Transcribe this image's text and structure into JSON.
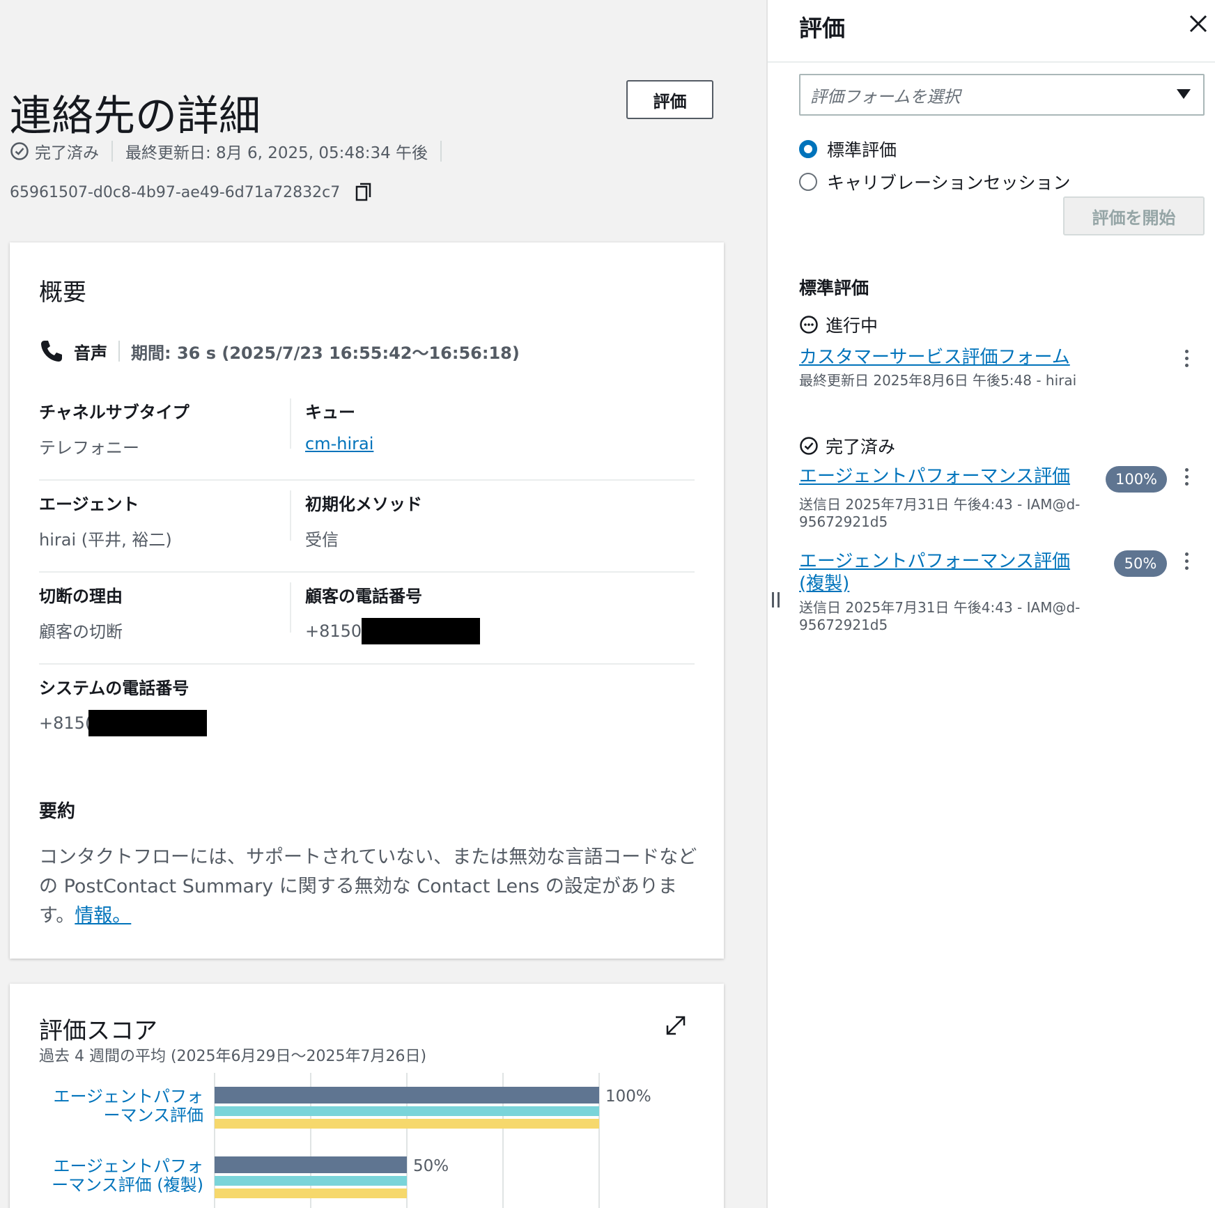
{
  "page": {
    "title": "連絡先の詳細",
    "evaluate_button": "評価",
    "status": "完了済み",
    "last_updated": "最終更新日: 8月 6, 2025, 05:48:34 午後",
    "contact_id": "65961507-d0c8-4b97-ae49-6d71a72832c7"
  },
  "overview": {
    "heading": "概要",
    "channel": "音声",
    "duration": "期間: 36 s (2025/7/23 16:55:42〜16:56:18)",
    "fields": [
      {
        "label": "チャネルサブタイプ",
        "value": "テレフォニー"
      },
      {
        "label": "キュー",
        "value": "cm-hirai"
      },
      {
        "label": "エージェント",
        "value": "hirai (平井, 裕二)"
      },
      {
        "label": "初期化メソッド",
        "value": "受信"
      },
      {
        "label": "切断の理由",
        "value": "顧客の切断"
      },
      {
        "label": "顧客の電話番号",
        "value": "+8150"
      },
      {
        "label": "システムの電話番号",
        "value": "+815("
      }
    ],
    "summary_heading": "要約",
    "summary_text": "コンタクトフローには、サポートされていない、または無効な言語コードなどの PostContact Summary に関する無効な Contact Lens の設定があります。",
    "summary_link": "情報。"
  },
  "score": {
    "heading": "評価スコア",
    "subtitle": "過去 4 週間の平均 (2025年6月29日〜2025年7月26日)"
  },
  "chart_data": {
    "type": "bar",
    "categories": [
      "エージェントパフォーマンス評価",
      "エージェントパフォーマンス評価 (複製)"
    ],
    "category_lines": [
      [
        "エージェントパフォ",
        "ーマンス評価"
      ],
      [
        "エージェントパフォ",
        "ーマンス評価 (複製)"
      ]
    ],
    "series": [
      {
        "values": [
          100,
          50
        ],
        "color": "#5f7591"
      },
      {
        "values": [
          100,
          50
        ],
        "color": "#7ad4d9"
      },
      {
        "values": [
          100,
          50
        ],
        "color": "#f6d86c"
      }
    ],
    "value_labels": [
      "100%",
      "50%"
    ],
    "xlim": [
      0,
      100
    ],
    "orientation": "horizontal",
    "grid": true
  },
  "panel": {
    "title": "評価",
    "select_placeholder": "評価フォームを選択",
    "radio_standard": "標準評価",
    "radio_calibration": "キャリブレーションセッション",
    "start_button": "評価を開始",
    "section_heading": "標準評価",
    "in_progress_label": "進行中",
    "in_progress_items": [
      {
        "name": "カスタマーサービス評価フォーム",
        "meta": "最終更新日 2025年8月6日 午後5:48 - hirai"
      }
    ],
    "completed_label": "完了済み",
    "completed_items": [
      {
        "name": "エージェントパフォーマンス評価",
        "badge": "100%",
        "meta": "送信日 2025年7月31日 午後4:43 - IAM@d-95672921d5"
      },
      {
        "name": "エージェントパフォーマンス評価 (複製)",
        "badge": "50%",
        "meta": "送信日 2025年7月31日 午後4:43 - IAM@d-95672921d5"
      }
    ]
  },
  "colors": {
    "link": "#0073bb",
    "badge": "#5f7591",
    "accent": "#0073bb"
  }
}
